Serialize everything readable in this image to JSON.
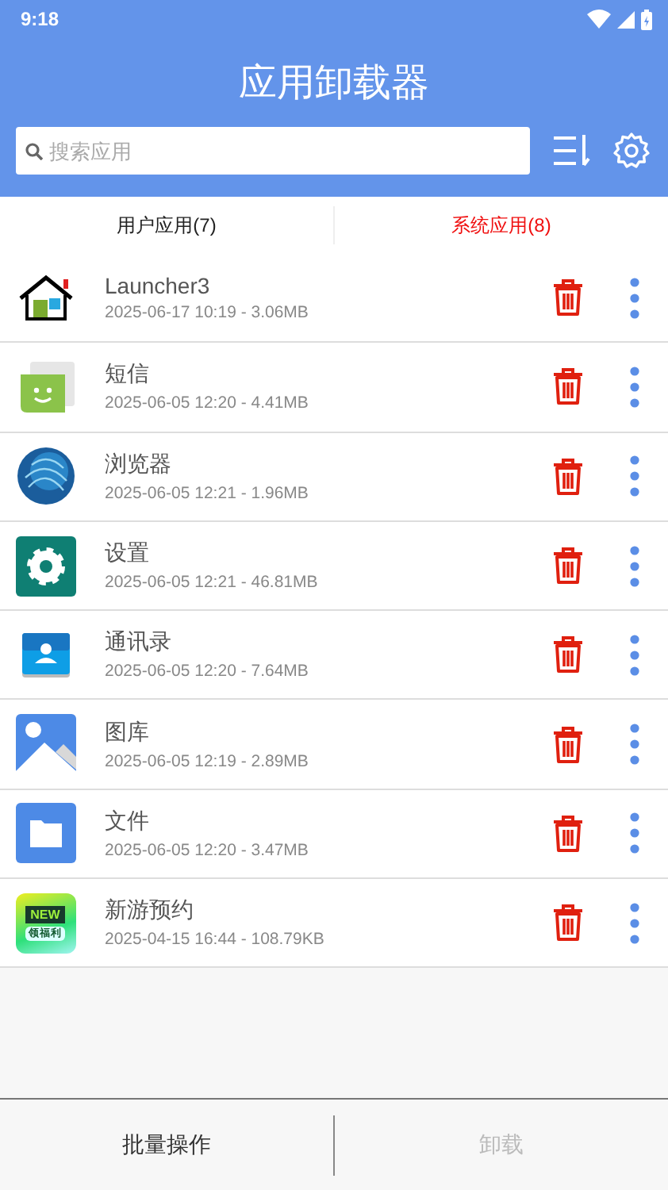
{
  "status_bar": {
    "time": "9:18"
  },
  "header": {
    "title": "应用卸载器"
  },
  "search": {
    "placeholder": "搜索应用"
  },
  "tabs": [
    {
      "label": "用户应用(7)",
      "selected": false
    },
    {
      "label": "系统应用(8)",
      "selected": true
    }
  ],
  "apps": [
    {
      "name": "Launcher3",
      "info": "2025-06-17 10:19 - 3.06MB",
      "kind": "home"
    },
    {
      "name": "短信",
      "info": "2025-06-05 12:20 - 4.41MB",
      "kind": "message"
    },
    {
      "name": "浏览器",
      "info": "2025-06-05 12:21 - 1.96MB",
      "kind": "globe"
    },
    {
      "name": "设置",
      "info": "2025-06-05 12:21 - 46.81MB",
      "kind": "gear"
    },
    {
      "name": "通讯录",
      "info": "2025-06-05 12:20 - 7.64MB",
      "kind": "contacts"
    },
    {
      "name": "图库",
      "info": "2025-06-05 12:19 - 2.89MB",
      "kind": "gallery"
    },
    {
      "name": "文件",
      "info": "2025-06-05 12:20 - 3.47MB",
      "kind": "folder"
    },
    {
      "name": "新游预约",
      "info": "2025-04-15 16:44 - 108.79KB",
      "kind": "promo",
      "icon_text": "NEW",
      "icon_subtext": "领福利"
    }
  ],
  "bottom_bar": [
    {
      "label": "批量操作",
      "disabled": false
    },
    {
      "label": "卸载",
      "disabled": true
    }
  ]
}
